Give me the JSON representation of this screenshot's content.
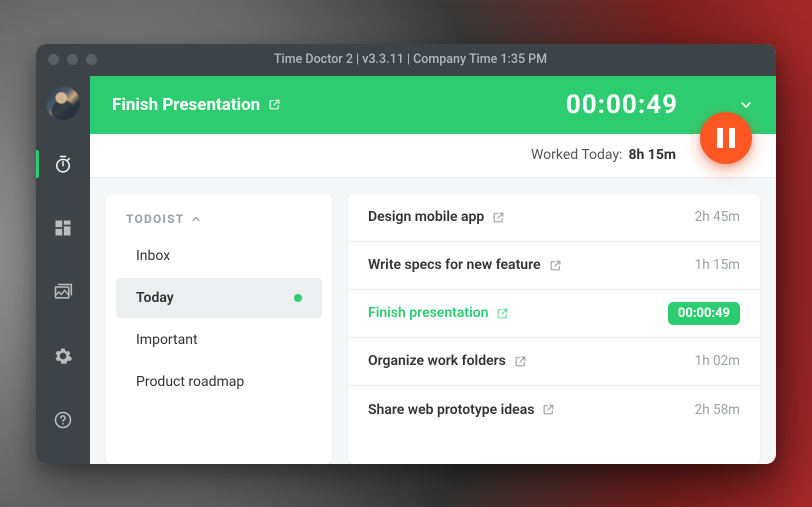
{
  "titlebar": "Time Doctor 2 | v3.3.11 | Company Time 1:35 PM",
  "header": {
    "task_title": "Finish Presentation",
    "timer": "00:00:49"
  },
  "worked_today": {
    "label": "Worked Today:",
    "value": "8h 15m"
  },
  "sidebar_group": {
    "label": "TODOIST",
    "items": [
      {
        "label": "Inbox",
        "active": false
      },
      {
        "label": "Today",
        "active": true
      },
      {
        "label": "Important",
        "active": false
      },
      {
        "label": "Product roadmap",
        "active": false
      }
    ]
  },
  "tasks": [
    {
      "name": "Design mobile app",
      "time": "2h 45m",
      "active": false
    },
    {
      "name": "Write specs for new feature",
      "time": "1h 15m",
      "active": false
    },
    {
      "name": "Finish presentation",
      "time": "00:00:49",
      "active": true
    },
    {
      "name": "Organize work folders",
      "time": "1h 02m",
      "active": false
    },
    {
      "name": "Share web prototype ideas",
      "time": "2h 58m",
      "active": false
    }
  ],
  "colors": {
    "accent": "#2ecc71",
    "pause": "#ff5722",
    "sidebar": "#3e4347"
  }
}
